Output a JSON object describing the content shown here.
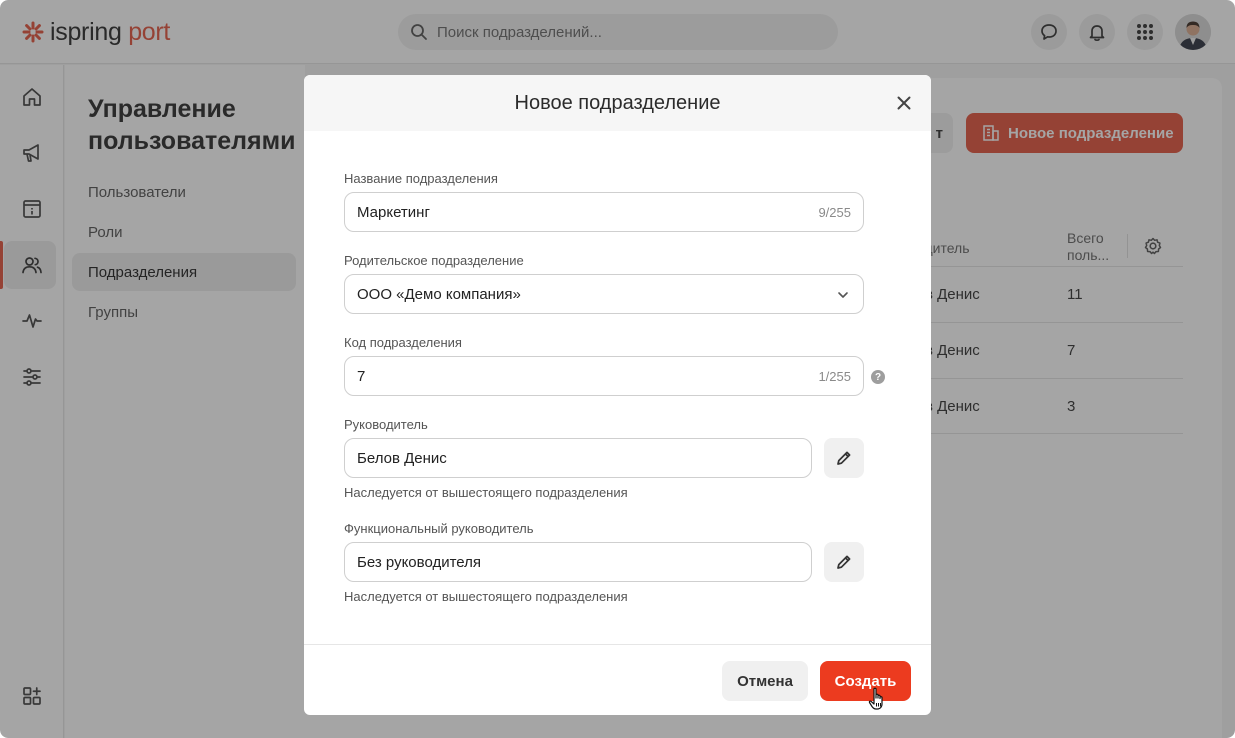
{
  "app": {
    "logo_main": "ispring",
    "logo_accent": "port",
    "brand_color": "#e4553e"
  },
  "search": {
    "placeholder": "Поиск подразделений..."
  },
  "topbar_icons": [
    "chat-icon",
    "bell-icon",
    "apps-grid-icon",
    "user-avatar"
  ],
  "rail": {
    "items": [
      "home-icon",
      "megaphone-icon",
      "calendar-info-icon",
      "users-icon",
      "activity-icon",
      "sliders-icon",
      "add-widget-icon"
    ],
    "active": "users-icon"
  },
  "subnav": {
    "title": "Управление пользователями",
    "items": [
      {
        "label": "Пользователи"
      },
      {
        "label": "Роли"
      },
      {
        "label": "Подразделения",
        "active": true
      },
      {
        "label": "Группы"
      }
    ]
  },
  "page": {
    "import_label": "т",
    "new_dept_label": "Новое подразделение",
    "table": {
      "col_head": "одитель",
      "col_total": "Всего поль...",
      "rows": [
        {
          "head": "в Денис",
          "total": "11"
        },
        {
          "head": "в Денис",
          "total": "7"
        },
        {
          "head": "в Денис",
          "total": "3"
        }
      ]
    }
  },
  "modal": {
    "title": "Новое подразделение",
    "fields": {
      "name": {
        "label": "Название подразделения",
        "value": "Маркетинг",
        "counter": "9/255"
      },
      "parent": {
        "label": "Родительское подразделение",
        "value": "ООО «Демо компания»"
      },
      "code": {
        "label": "Код подразделения",
        "value": "7",
        "counter": "1/255",
        "help": "?"
      },
      "head": {
        "label": "Руководитель",
        "value": "Белов Денис",
        "hint": "Наследуется от вышестоящего подразделения"
      },
      "func_head": {
        "label": "Функциональный руководитель",
        "value": "Без руководителя",
        "hint": "Наследуется от вышестоящего подразделения"
      }
    },
    "cancel_label": "Отмена",
    "create_label": "Создать"
  }
}
